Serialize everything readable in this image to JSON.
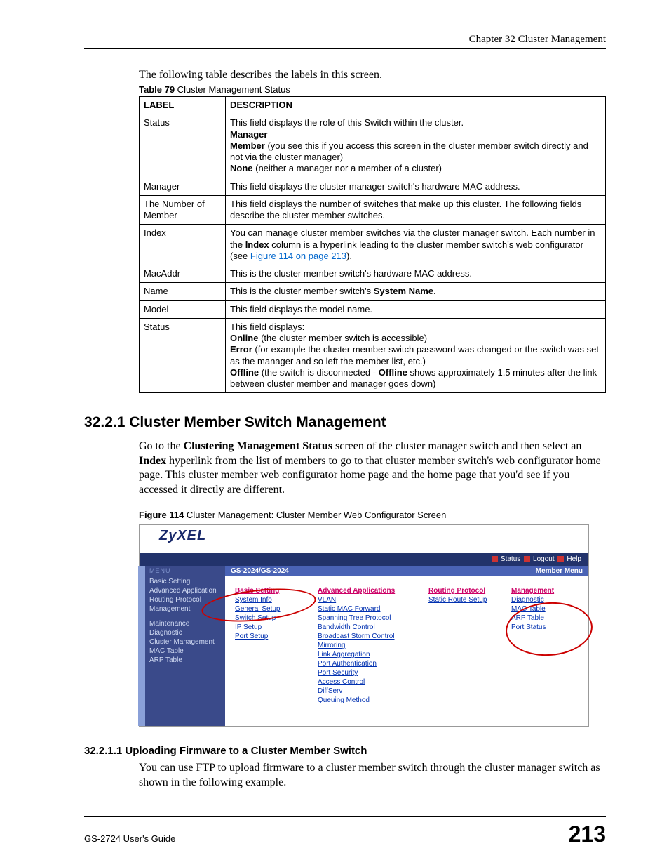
{
  "header": {
    "chapter": "Chapter 32 Cluster Management"
  },
  "intro": "The following table describes the labels in this screen.",
  "tableCaption": {
    "bold": "Table 79",
    "rest": "   Cluster Management Status"
  },
  "tableHeaders": {
    "c1": "LABEL",
    "c2": "DESCRIPTION"
  },
  "rows": {
    "status": {
      "label": "Status",
      "l1": "This field displays the role of this Switch within the cluster.",
      "mgr": "Manager",
      "memA": "Member",
      "memB": " (you see this if you access this screen in the cluster member switch directly and not via the cluster manager)",
      "noneA": "None",
      "noneB": " (neither a manager nor a member of a cluster)"
    },
    "manager": {
      "label": "Manager",
      "txt": "This field displays the cluster manager switch's hardware MAC address."
    },
    "num": {
      "label": "The Number of Member",
      "txt": "This field displays the number of switches that make up this cluster. The following fields describe the cluster member switches."
    },
    "index": {
      "label": "Index",
      "a": "You can manage cluster member switches via the cluster manager switch. Each number in the ",
      "b": "Index",
      "c": " column is a hyperlink leading to the cluster member switch's web configurator (see ",
      "d": "Figure 114 on page 213",
      "e": ")."
    },
    "mac": {
      "label": "MacAddr",
      "txt": "This is the cluster member switch's hardware MAC address."
    },
    "name": {
      "label": "Name",
      "a": "This is the cluster member switch's ",
      "b": "System Name",
      "c": "."
    },
    "model": {
      "label": "Model",
      "txt": "This field displays the model name."
    },
    "status2": {
      "label": "Status",
      "l1": "This field displays:",
      "onA": "Online",
      "onB": " (the cluster member switch is accessible)",
      "errA": "Error",
      "errB": " (for example the cluster member switch password was changed or the switch was set as the manager and so left the member list, etc.)",
      "offA": "Offline",
      "offB": " (the switch is disconnected - ",
      "offC": "Offline",
      "offD": " shows approximately 1.5 minutes after the link between cluster member and manager goes down)"
    }
  },
  "heading1": "32.2.1  Cluster Member Switch Management",
  "para1": {
    "a": "Go to the ",
    "b": "Clustering Management Status",
    "c": " screen of the cluster manager switch and then select an ",
    "d": "Index",
    "e": " hyperlink from the list of members to go to that cluster member switch's web configurator home page. This cluster member web configurator home page and the home page that you'd see if you accessed it directly are different."
  },
  "figureCaption": {
    "bold": "Figure 114",
    "rest": "   Cluster Management: Cluster Member Web Configurator Screen"
  },
  "shot": {
    "logo": "ZyXEL",
    "statusbar": {
      "status": "Status",
      "logout": "Logout",
      "help": "Help"
    },
    "sidebar": {
      "menuLabel": "MENU",
      "group1": [
        "Basic Setting",
        "Advanced Application",
        "Routing Protocol",
        "Management"
      ],
      "group2": [
        "Maintenance",
        "Diagnostic",
        "Cluster Management",
        "MAC Table",
        "ARP Table"
      ]
    },
    "titleLeft": "GS-2024/GS-2024",
    "titleRight": "Member Menu",
    "cols": {
      "basic": {
        "head": "Basic Setting",
        "items": [
          "System Info",
          "General Setup",
          "Switch Setup",
          "IP Setup",
          "Port Setup"
        ]
      },
      "adv": {
        "head": "Advanced Applications",
        "items": [
          "VLAN",
          "Static MAC Forward",
          "Spanning Tree Protocol",
          "Bandwidth Control",
          "Broadcast Storm Control",
          "Mirroring",
          "Link Aggregation",
          "Port Authentication",
          "Port Security",
          "Access Control",
          "DiffServ",
          "Queuing Method"
        ]
      },
      "rout": {
        "head": "Routing Protocol",
        "items": [
          "Static Route Setup"
        ]
      },
      "mgmt": {
        "head": "Management",
        "items": [
          "Diagnostic",
          "MAC Table",
          "ARP Table",
          "Port Status"
        ]
      }
    }
  },
  "heading2": "32.2.1.1  Uploading Firmware to a Cluster Member Switch",
  "para2": "You can use FTP to upload firmware to a cluster member switch through the cluster manager switch as shown in the following example.",
  "footer": {
    "guide": "GS-2724 User's Guide",
    "page": "213"
  }
}
